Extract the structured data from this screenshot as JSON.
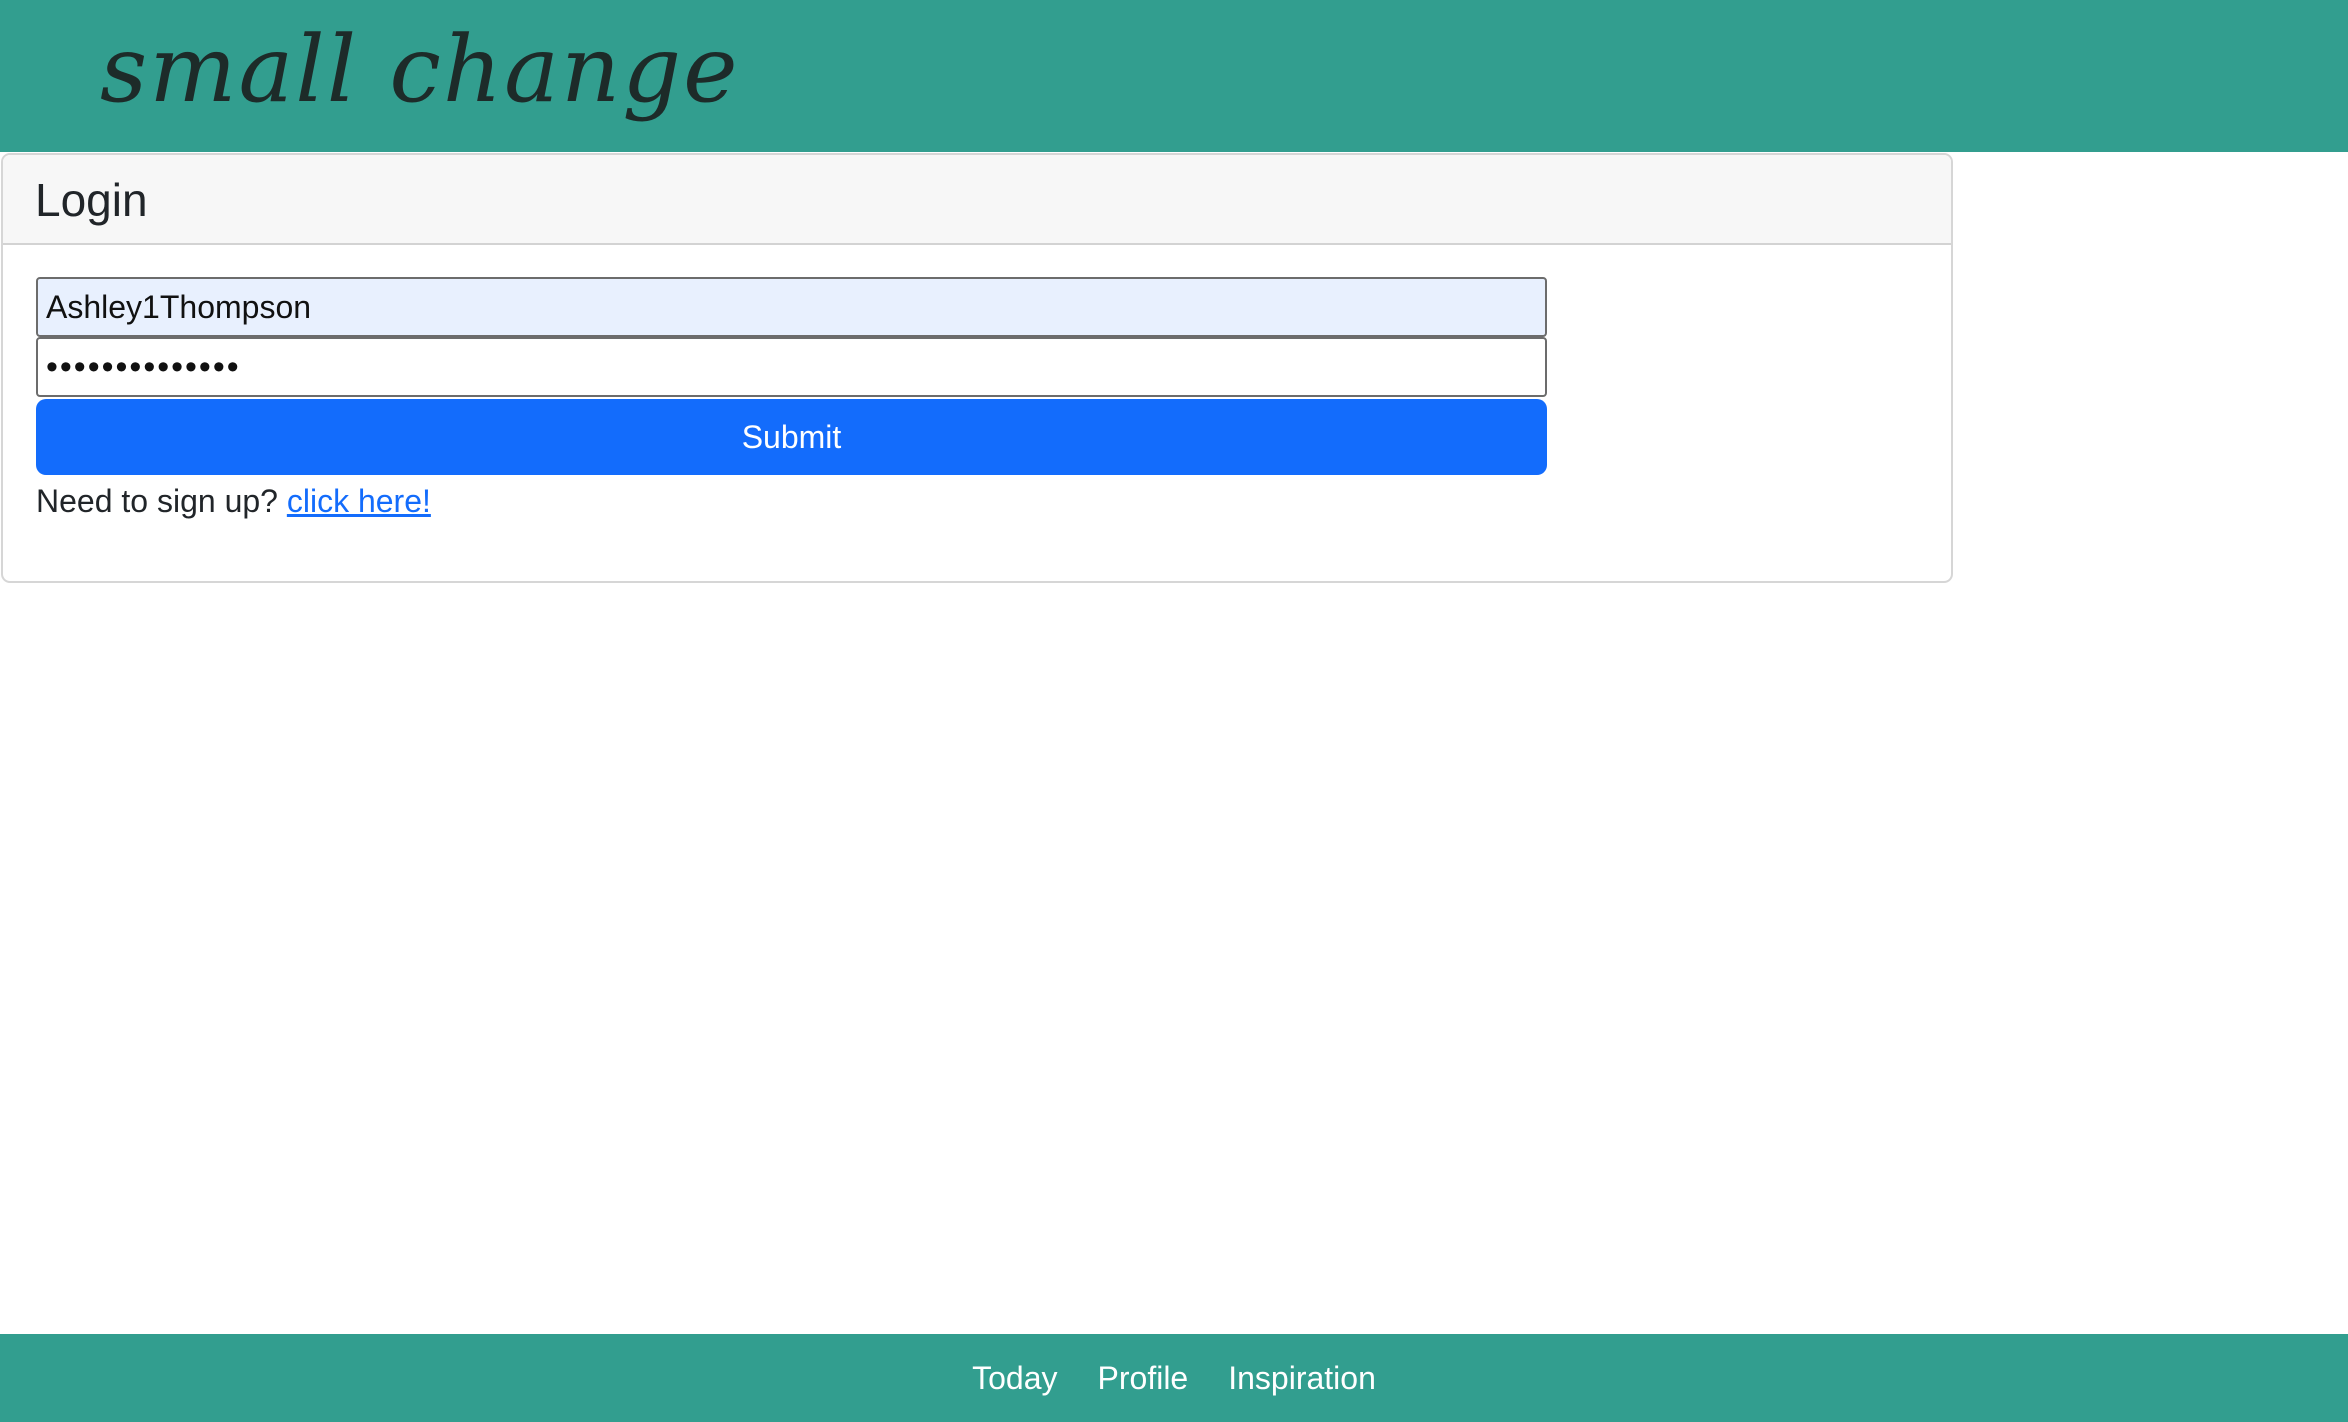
{
  "header": {
    "brand": "small change"
  },
  "login": {
    "title": "Login",
    "username_value": "Ashley1Thompson",
    "password_masked": "••••••••••••••",
    "submit_label": "Submit",
    "signup_prompt": "Need to sign up?",
    "signup_link": "click here!"
  },
  "footer": {
    "links": [
      "Today",
      "Profile",
      "Inspiration"
    ]
  },
  "colors": {
    "header_bg": "#329e8f",
    "primary": "#136cfc",
    "autofill_bg": "#e8f0fe"
  }
}
